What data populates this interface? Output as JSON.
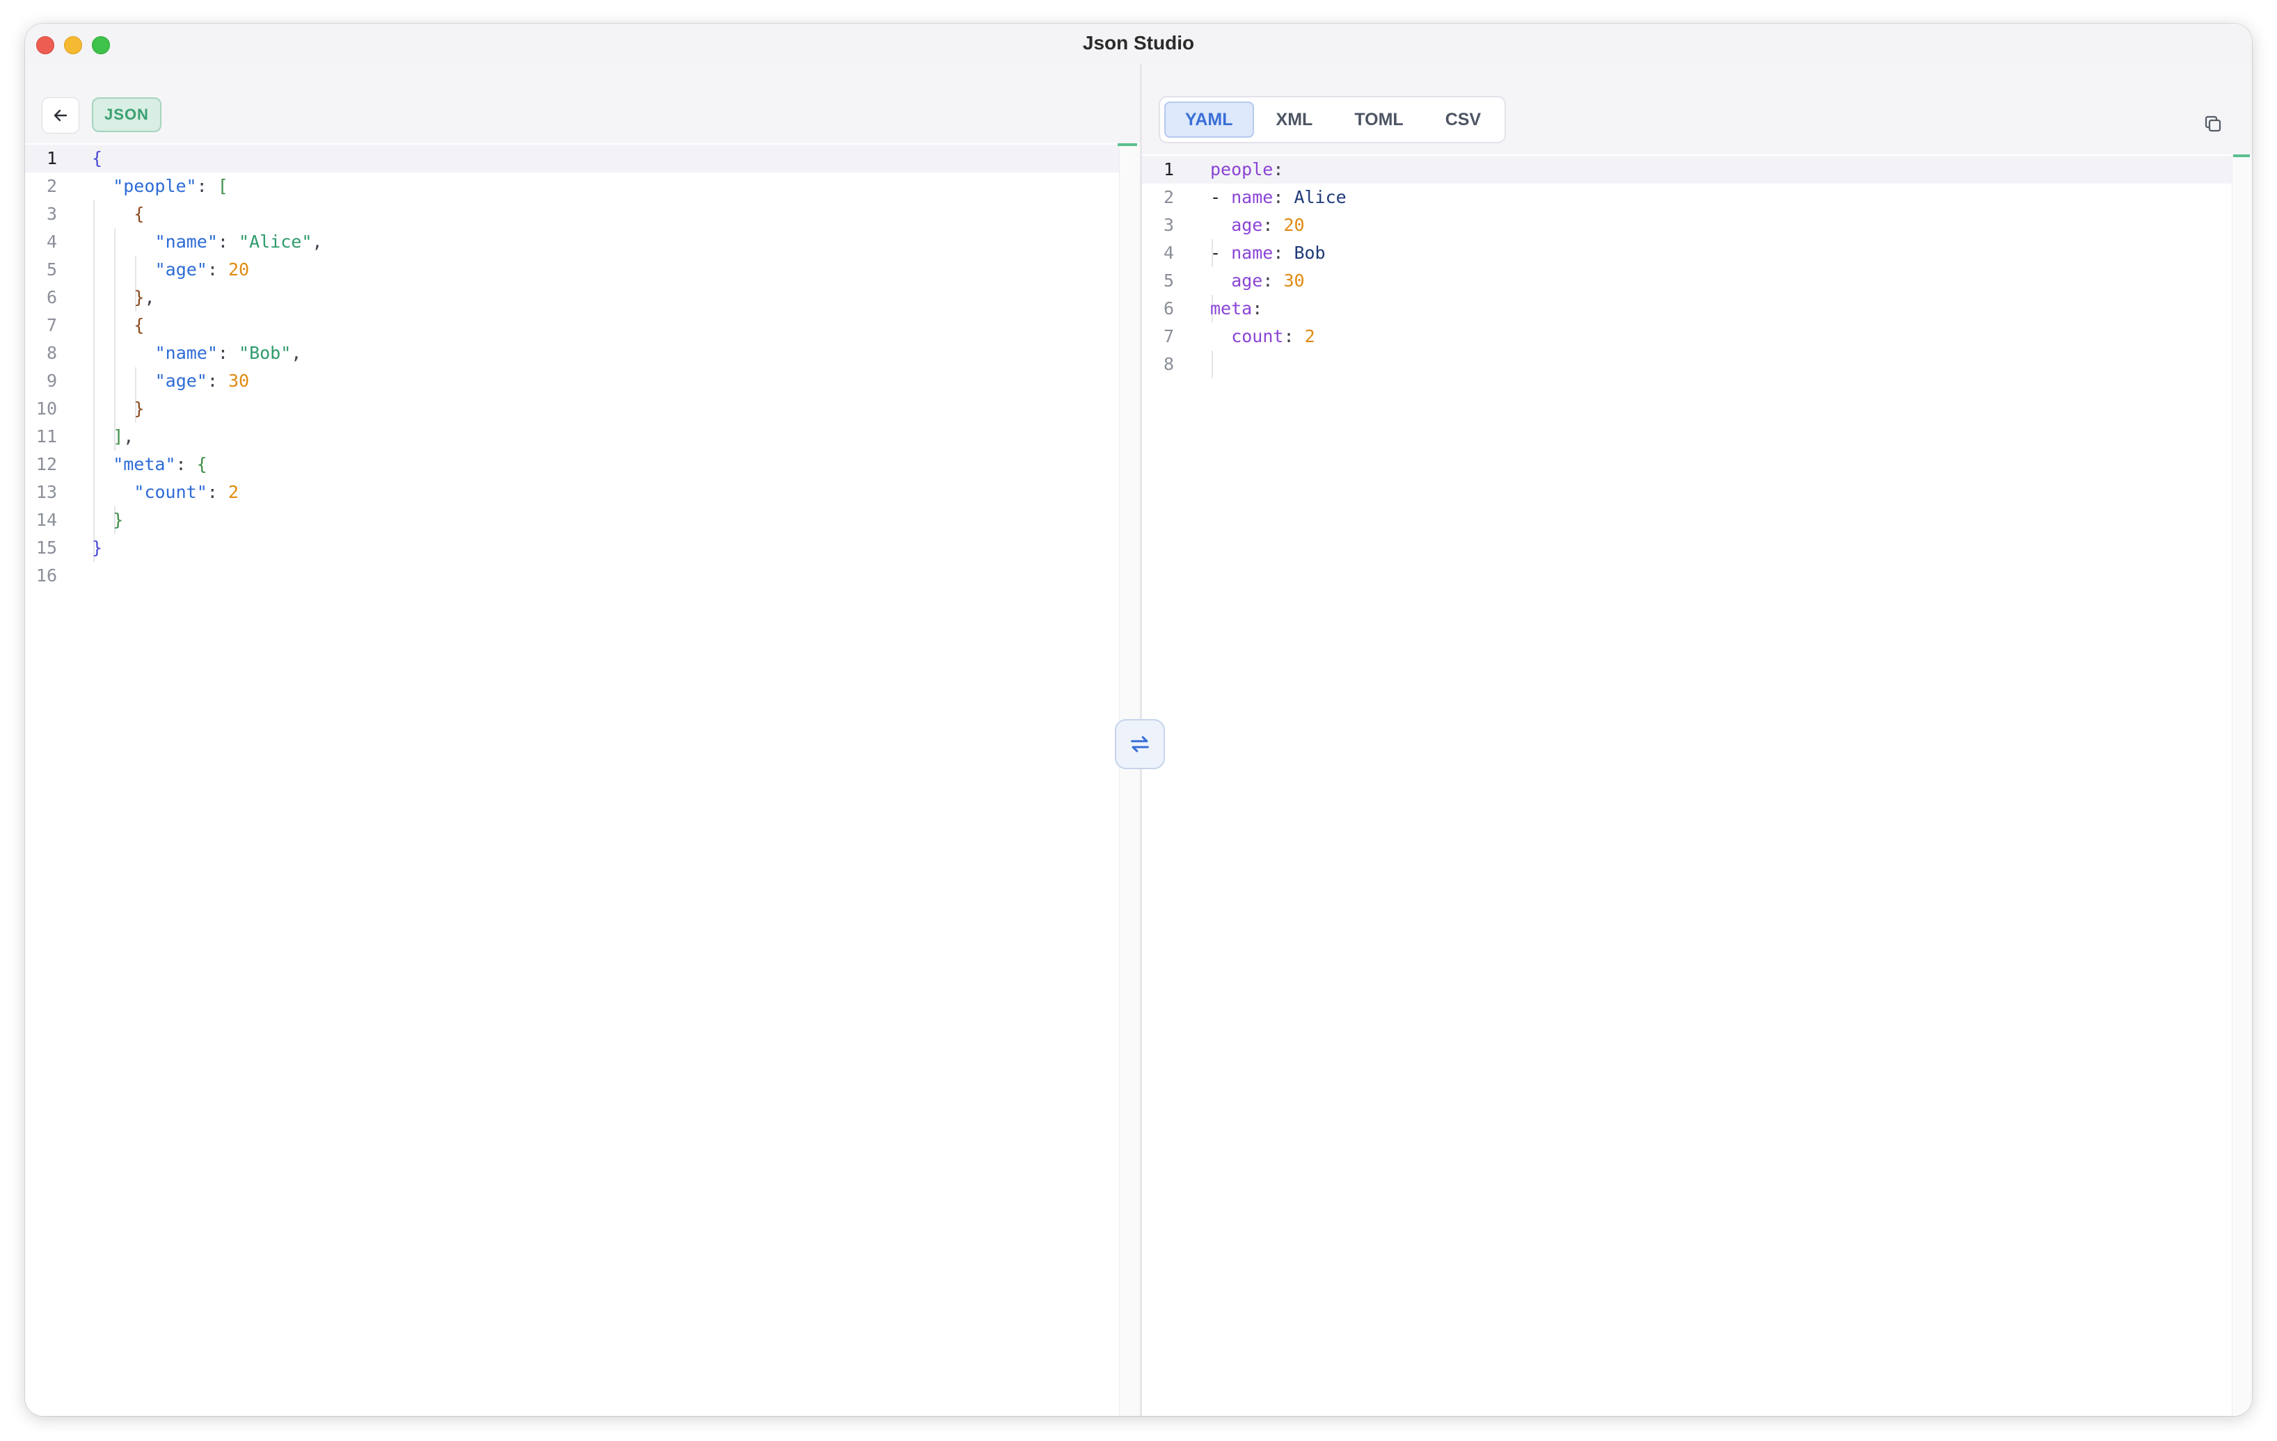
{
  "window": {
    "title": "Json Studio"
  },
  "left": {
    "format_badge": "JSON",
    "lines": [
      {
        "n": "1",
        "tokens": [
          {
            "t": "{",
            "c": "p-brace"
          }
        ]
      },
      {
        "n": "2",
        "tokens": [
          {
            "t": "\"people\"",
            "c": "p-key"
          },
          {
            "t": ": ",
            "c": "p-punc"
          },
          {
            "t": "[",
            "c": "p-bracket"
          }
        ]
      },
      {
        "n": "3",
        "tokens": [
          {
            "t": "{",
            "c": "p-brace2"
          }
        ]
      },
      {
        "n": "4",
        "tokens": [
          {
            "t": "\"name\"",
            "c": "p-key"
          },
          {
            "t": ": ",
            "c": "p-punc"
          },
          {
            "t": "\"Alice\"",
            "c": "p-str"
          },
          {
            "t": ",",
            "c": "p-punc"
          }
        ]
      },
      {
        "n": "5",
        "tokens": [
          {
            "t": "\"age\"",
            "c": "p-key"
          },
          {
            "t": ": ",
            "c": "p-punc"
          },
          {
            "t": "20",
            "c": "p-num"
          }
        ]
      },
      {
        "n": "6",
        "tokens": [
          {
            "t": "}",
            "c": "p-brace2"
          },
          {
            "t": ",",
            "c": "p-punc"
          }
        ]
      },
      {
        "n": "7",
        "tokens": [
          {
            "t": "{",
            "c": "p-brace2"
          }
        ]
      },
      {
        "n": "8",
        "tokens": [
          {
            "t": "\"name\"",
            "c": "p-key"
          },
          {
            "t": ": ",
            "c": "p-punc"
          },
          {
            "t": "\"Bob\"",
            "c": "p-str"
          },
          {
            "t": ",",
            "c": "p-punc"
          }
        ]
      },
      {
        "n": "9",
        "tokens": [
          {
            "t": "\"age\"",
            "c": "p-key"
          },
          {
            "t": ": ",
            "c": "p-punc"
          },
          {
            "t": "30",
            "c": "p-num"
          }
        ]
      },
      {
        "n": "10",
        "tokens": [
          {
            "t": "}",
            "c": "p-brace2"
          }
        ]
      },
      {
        "n": "11",
        "tokens": [
          {
            "t": "]",
            "c": "p-bracket"
          },
          {
            "t": ",",
            "c": "p-punc"
          }
        ]
      },
      {
        "n": "12",
        "tokens": [
          {
            "t": "\"meta\"",
            "c": "p-key"
          },
          {
            "t": ": ",
            "c": "p-punc"
          },
          {
            "t": "{",
            "c": "p-brace3"
          }
        ]
      },
      {
        "n": "13",
        "tokens": [
          {
            "t": "\"count\"",
            "c": "p-key"
          },
          {
            "t": ": ",
            "c": "p-punc"
          },
          {
            "t": "2",
            "c": "p-num"
          }
        ]
      },
      {
        "n": "14",
        "tokens": [
          {
            "t": "}",
            "c": "p-brace3"
          }
        ]
      },
      {
        "n": "15",
        "tokens": [
          {
            "t": "}",
            "c": "p-brace"
          }
        ]
      },
      {
        "n": "16",
        "tokens": []
      }
    ]
  },
  "right": {
    "tabs": [
      {
        "label": "YAML",
        "active": true
      },
      {
        "label": "XML",
        "active": false
      },
      {
        "label": "TOML",
        "active": false
      },
      {
        "label": "CSV",
        "active": false
      }
    ],
    "lines": [
      {
        "n": "1",
        "tokens": [
          {
            "t": "people",
            "c": "y-key"
          },
          {
            "t": ":",
            "c": "p-punc"
          }
        ]
      },
      {
        "n": "2",
        "tokens": [
          {
            "t": "- ",
            "c": "y-dash"
          },
          {
            "t": "name",
            "c": "y-key"
          },
          {
            "t": ": ",
            "c": "p-punc"
          },
          {
            "t": "Alice",
            "c": "y-val"
          }
        ]
      },
      {
        "n": "3",
        "tokens": [
          {
            "t": "age",
            "c": "y-key"
          },
          {
            "t": ": ",
            "c": "p-punc"
          },
          {
            "t": "20",
            "c": "y-num"
          }
        ]
      },
      {
        "n": "4",
        "tokens": [
          {
            "t": "- ",
            "c": "y-dash"
          },
          {
            "t": "name",
            "c": "y-key"
          },
          {
            "t": ": ",
            "c": "p-punc"
          },
          {
            "t": "Bob",
            "c": "y-val"
          }
        ]
      },
      {
        "n": "5",
        "tokens": [
          {
            "t": "age",
            "c": "y-key"
          },
          {
            "t": ": ",
            "c": "p-punc"
          },
          {
            "t": "30",
            "c": "y-num"
          }
        ]
      },
      {
        "n": "6",
        "tokens": [
          {
            "t": "meta",
            "c": "y-key"
          },
          {
            "t": ":",
            "c": "p-punc"
          }
        ]
      },
      {
        "n": "7",
        "tokens": [
          {
            "t": "count",
            "c": "y-key"
          },
          {
            "t": ": ",
            "c": "p-punc"
          },
          {
            "t": "2",
            "c": "y-num"
          }
        ]
      },
      {
        "n": "8",
        "tokens": []
      }
    ]
  },
  "icons": {
    "back": "arrow-left-icon",
    "swap": "swap-arrows-icon",
    "copy": "copy-icon"
  },
  "colors": {
    "accent_green": "#3a9f71",
    "accent_blue": "#3a6fd6"
  }
}
